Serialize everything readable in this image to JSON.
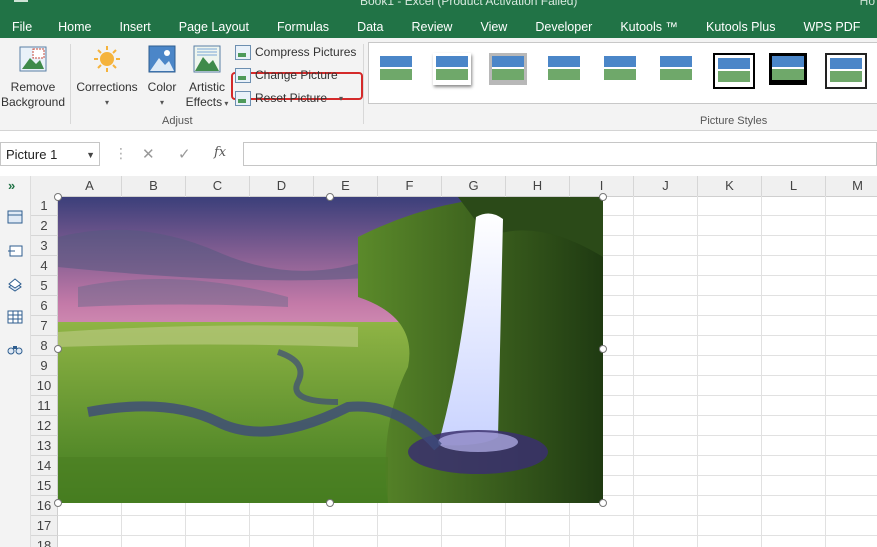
{
  "title_fragment": "Book1 - Excel (Product Activation Failed)",
  "tabs": [
    "File",
    "Home",
    "Insert",
    "Page Layout",
    "Formulas",
    "Data",
    "Review",
    "View",
    "Developer",
    "Kutools ™",
    "Kutools Plus",
    "WPS PDF"
  ],
  "ribbon": {
    "remove_background": {
      "line1": "Remove",
      "line2": "Background",
      "icon": "remove-background-icon"
    },
    "corrections": {
      "label": "Corrections",
      "icon": "sun-icon"
    },
    "color": {
      "label": "Color",
      "icon": "color-icon"
    },
    "artistic": {
      "line1": "Artistic",
      "line2": "Effects",
      "icon": "artistic-effects-icon"
    },
    "compress": "Compress Pictures",
    "change": "Change Picture",
    "reset": "Reset Picture",
    "adjust_group": "Adjust",
    "styles_group": "Picture Styles",
    "style_thumbnails": 9
  },
  "formula_bar": {
    "name_box": "Picture 1",
    "cancel_icon": "cancel-icon",
    "enter_icon": "check-icon",
    "fx": "fx",
    "formula": ""
  },
  "columns": [
    "A",
    "B",
    "C",
    "D",
    "E",
    "F",
    "G",
    "H",
    "I",
    "J",
    "K",
    "L",
    "M"
  ],
  "rows": [
    "1",
    "2",
    "3",
    "4",
    "5",
    "6",
    "7",
    "8",
    "9",
    "10",
    "11",
    "12",
    "13",
    "14",
    "15",
    "16",
    "17",
    "18"
  ],
  "picture": {
    "description_name": "waterfall-landscape-picture"
  },
  "colors": {
    "excel_green": "#217346",
    "highlight_red": "#d42a2a"
  }
}
